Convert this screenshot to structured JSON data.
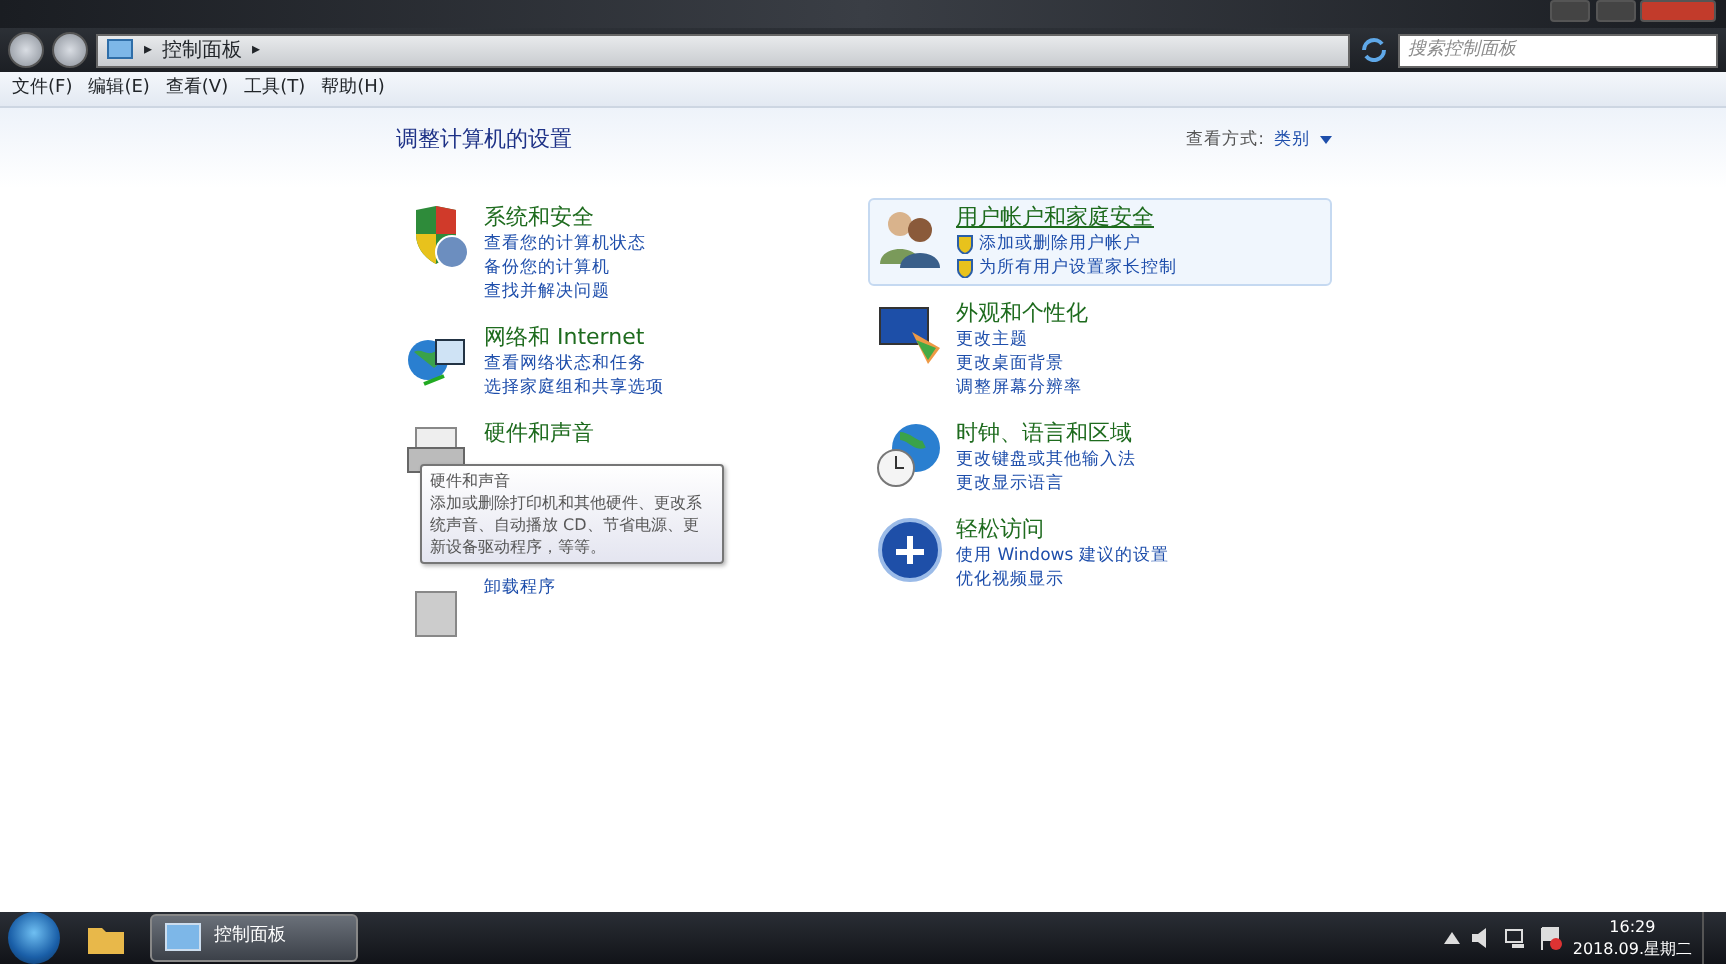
{
  "address_bar": {
    "path": [
      {
        "kind": "separator",
        "text": "▸"
      },
      {
        "kind": "crumb",
        "text": "控制面板"
      },
      {
        "kind": "separator",
        "text": "▸"
      }
    ]
  },
  "search": {
    "placeholder": "搜索控制面板"
  },
  "menu": [
    "文件(F)",
    "编辑(E)",
    "查看(V)",
    "工具(T)",
    "帮助(H)"
  ],
  "heading": "调整计算机的设置",
  "view_by": {
    "label": "查看方式:",
    "value": "类别"
  },
  "categories": [
    {
      "kind": "security",
      "title": "系统和安全",
      "links": [
        {
          "text": "查看您的计算机状态"
        },
        {
          "text": "备份您的计算机"
        },
        {
          "text": "查找并解决问题"
        }
      ]
    },
    {
      "kind": "network",
      "title": "网络和 Internet",
      "links": [
        {
          "text": "查看网络状态和任务"
        },
        {
          "text": "选择家庭组和共享选项"
        }
      ]
    },
    {
      "kind": "hardware",
      "title": "硬件和声音"
    },
    {
      "kind": "programs",
      "links": [
        {
          "text": "卸载程序"
        }
      ]
    },
    {
      "kind": "users",
      "title": "用户帐户和家庭安全",
      "hovered": true,
      "links": [
        {
          "text": "添加或删除用户帐户",
          "shield": true
        },
        {
          "text": "为所有用户设置家长控制",
          "shield": true
        }
      ]
    },
    {
      "kind": "appearance",
      "title": "外观和个性化",
      "links": [
        {
          "text": "更改主题"
        },
        {
          "text": "更改桌面背景"
        },
        {
          "text": "调整屏幕分辨率"
        }
      ]
    },
    {
      "kind": "clock",
      "title": "时钟、语言和区域",
      "links": [
        {
          "text": "更改键盘或其他输入法"
        },
        {
          "text": "更改显示语言"
        }
      ]
    },
    {
      "kind": "access",
      "title": "轻松访问",
      "links": [
        {
          "text": "使用 Windows 建议的设置"
        },
        {
          "text": "优化视频显示"
        }
      ]
    }
  ],
  "tooltip": {
    "title": "硬件和声音",
    "text": "添加或删除打印机和其他硬件、更改系统声音、自动播放 CD、节省电源、更新设备驱动程序，等等。"
  },
  "taskbar": {
    "items": [
      {
        "kind": "explorer",
        "selected": false
      },
      {
        "kind": "control",
        "label": "控制面板",
        "selected": true
      }
    ],
    "time": "16:29",
    "date": "2018.09.星期二"
  }
}
